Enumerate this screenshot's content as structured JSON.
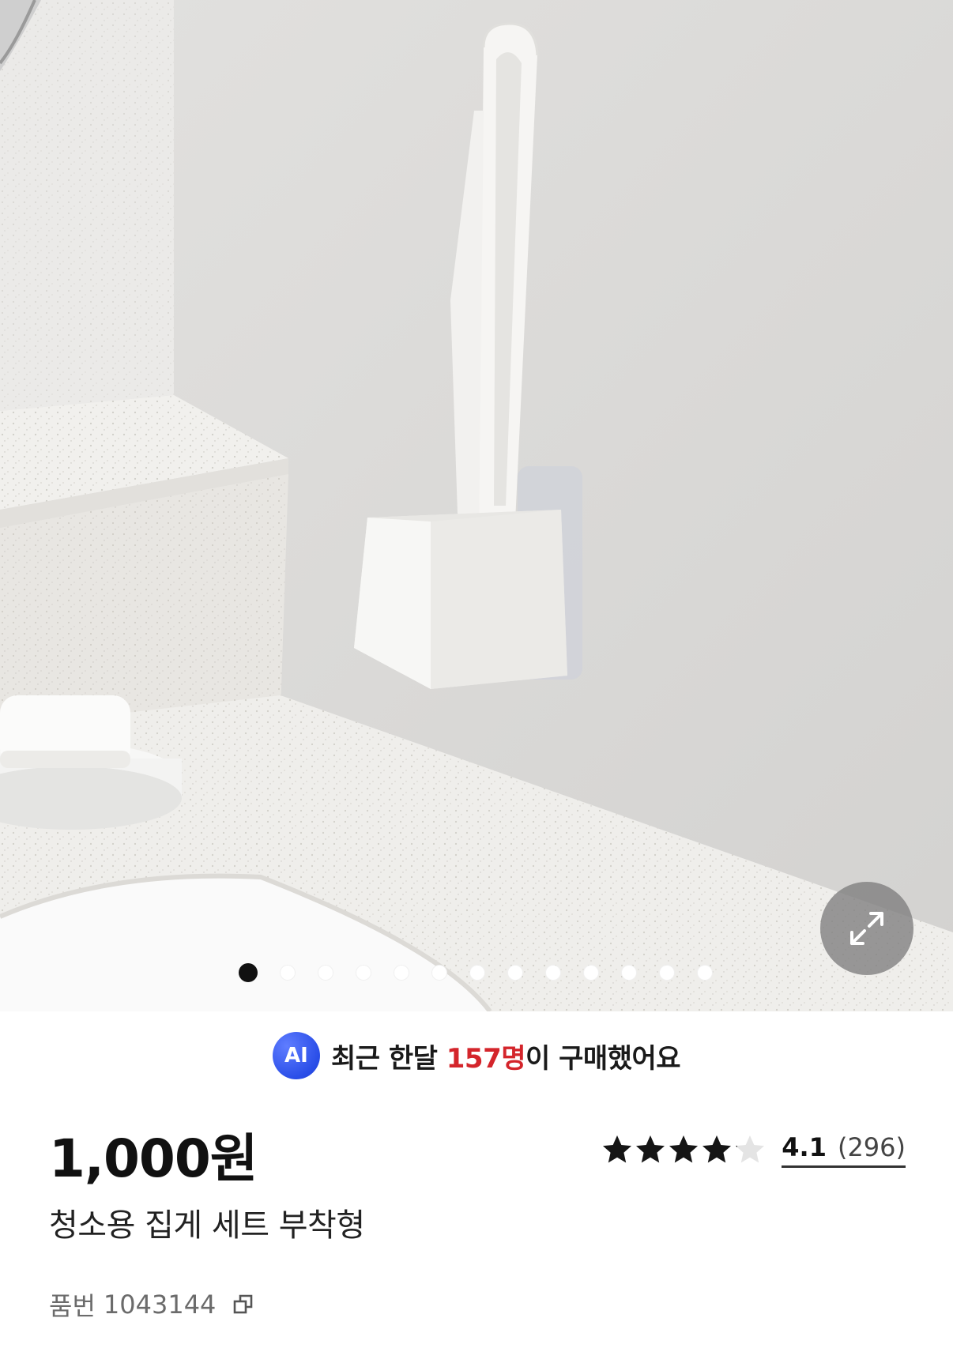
{
  "gallery": {
    "slide_count": 13,
    "active_index": 0,
    "expand_icon": "expand-arrows-icon"
  },
  "ai_banner": {
    "badge": "AI",
    "text_before": "최근 한달 ",
    "count": "157명",
    "text_after": "이 구매했어요",
    "accent_color": "#d4252b",
    "badge_color": "#2a4ee8"
  },
  "product": {
    "price": "1,000원",
    "name": "청소용 집게 세트 부착형",
    "sku_label": "품번",
    "sku_number": "1043144",
    "copy_icon": "copy-icon"
  },
  "rating": {
    "value": "4.1",
    "count": "(296)",
    "stars_filled": 4.1,
    "stars_total": 5
  }
}
